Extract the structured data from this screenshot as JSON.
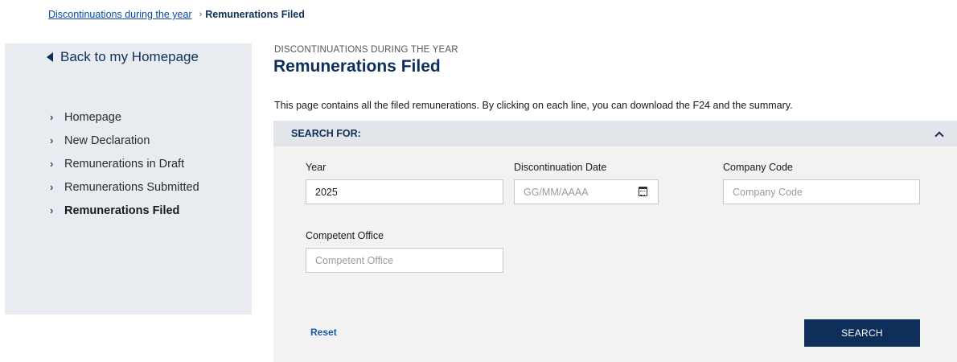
{
  "breadcrumb": {
    "parent": "Discontinuations during the year",
    "current": "Remunerations Filed"
  },
  "sidebar": {
    "back_label": "Back to my Homepage",
    "items": [
      {
        "label": "Homepage"
      },
      {
        "label": "New Declaration"
      },
      {
        "label": "Remunerations in Draft"
      },
      {
        "label": "Remunerations Submitted"
      },
      {
        "label": "Remunerations Filed",
        "active": true
      }
    ]
  },
  "main": {
    "overline": "DISCONTINUATIONS DURING THE YEAR",
    "title": "Remunerations Filed",
    "intro": "This page contains all the filed remunerations. By clicking on each line, you can download the F24 and the summary."
  },
  "search": {
    "header": "SEARCH FOR:",
    "year": {
      "label": "Year",
      "value": "2025"
    },
    "date": {
      "label": "Discontinuation Date",
      "placeholder": "GG/MM/AAAA"
    },
    "company": {
      "label": "Company Code",
      "placeholder": "Company Code"
    },
    "office": {
      "label": "Competent Office",
      "placeholder": "Competent Office"
    },
    "reset_label": "Reset",
    "search_label": "SEARCH"
  },
  "colors": {
    "primary": "#0e2f5a",
    "link": "#0b4aa2",
    "sidebar_bg": "#e8ecf1",
    "panel_bg": "#f2f2f2"
  }
}
